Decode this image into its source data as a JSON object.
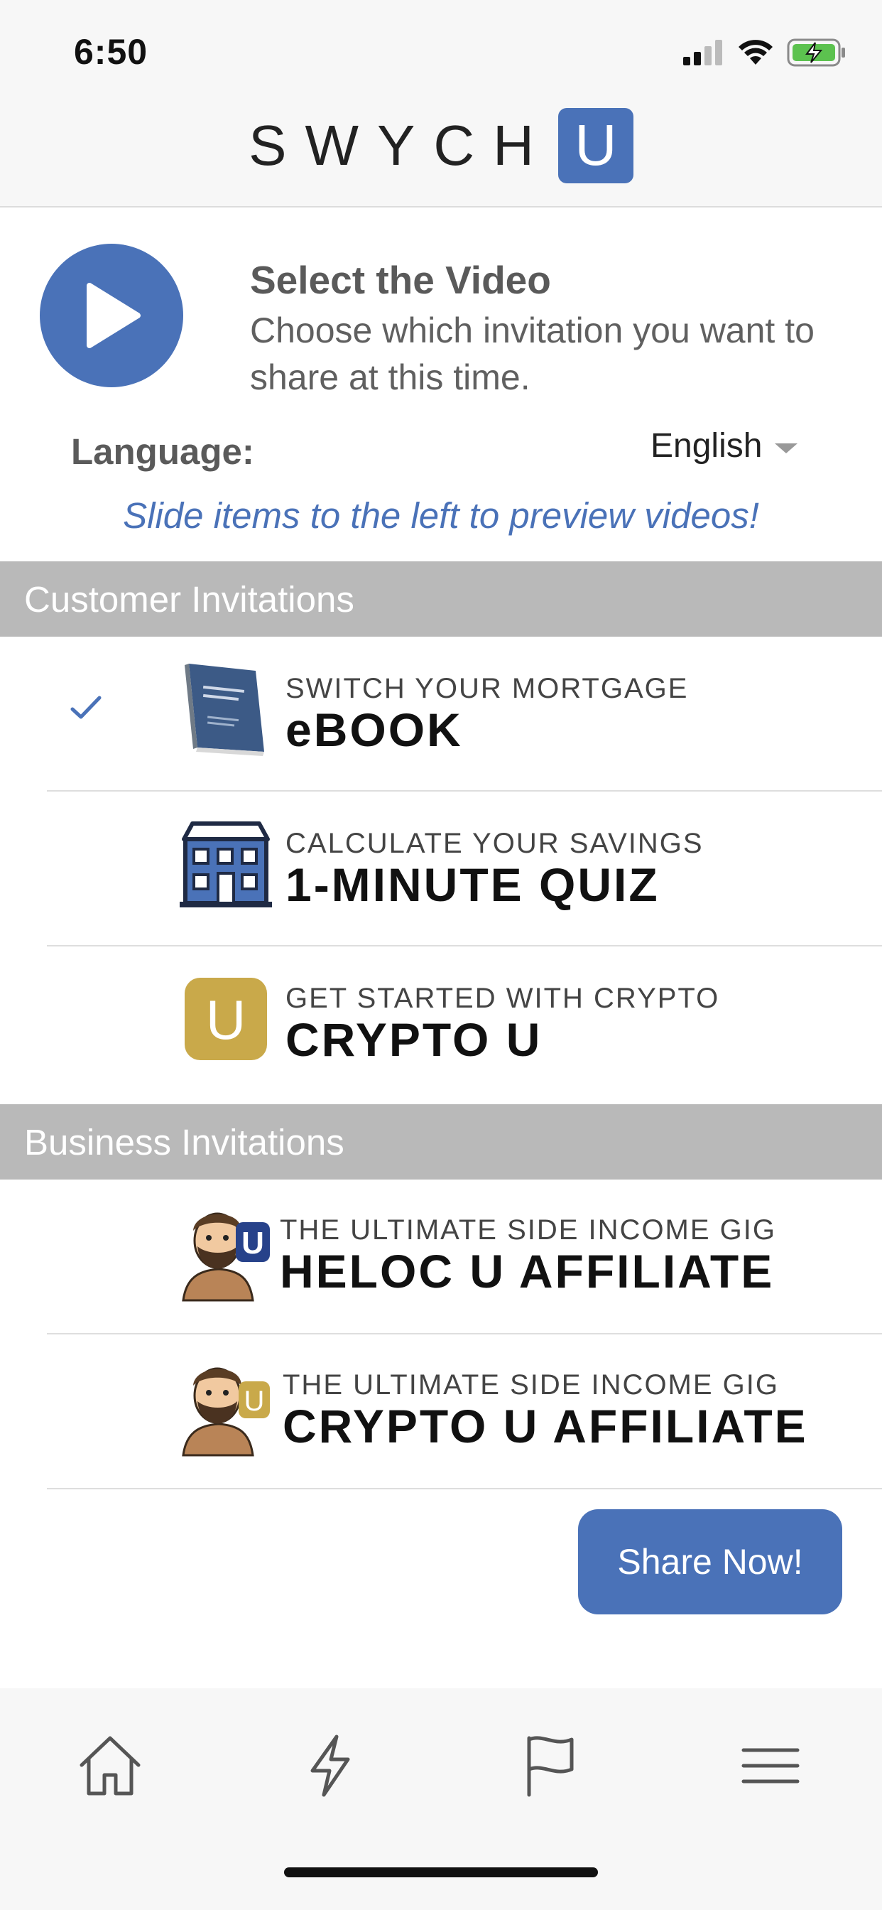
{
  "status_bar": {
    "time": "6:50"
  },
  "app": {
    "logo_text": "SWYCH",
    "logo_badge": "U"
  },
  "intro": {
    "title": "Select the Video",
    "description": "Choose which invitation you want to share at this time."
  },
  "language": {
    "label": "Language:",
    "selected": "English"
  },
  "hint": "Slide items to the left to preview videos!",
  "sections": {
    "customer": {
      "title": "Customer Invitations",
      "items": [
        {
          "subtitle": "SWITCH YOUR MORTGAGE",
          "title": "eBOOK",
          "selected": true,
          "icon": "ebook-cover-icon"
        },
        {
          "subtitle": "CALCULATE YOUR SAVINGS",
          "title": "1-MINUTE QUIZ",
          "selected": false,
          "icon": "house-icon"
        },
        {
          "subtitle": "GET STARTED WITH CRYPTO",
          "title": "CRYPTO U",
          "selected": false,
          "icon": "crypto-u-badge-icon"
        }
      ]
    },
    "business": {
      "title": "Business Invitations",
      "items": [
        {
          "subtitle": "THE ULTIMATE SIDE INCOME GIG",
          "title": "HELOC U AFFILIATE",
          "selected": false,
          "icon": "caveman-heloc-icon",
          "badge": "U"
        },
        {
          "subtitle": "THE ULTIMATE SIDE INCOME GIG",
          "title": "CRYPTO U AFFILIATE",
          "selected": false,
          "icon": "caveman-crypto-icon",
          "badge": "U"
        }
      ]
    }
  },
  "share_button": "Share Now!",
  "nav": [
    "home-icon",
    "lightning-icon",
    "flag-icon",
    "menu-icon"
  ],
  "colors": {
    "accent": "#4a72b8",
    "gold": "#c9a94a",
    "section_bg": "#b9b9b9",
    "bar_bg": "#f7f7f7"
  }
}
